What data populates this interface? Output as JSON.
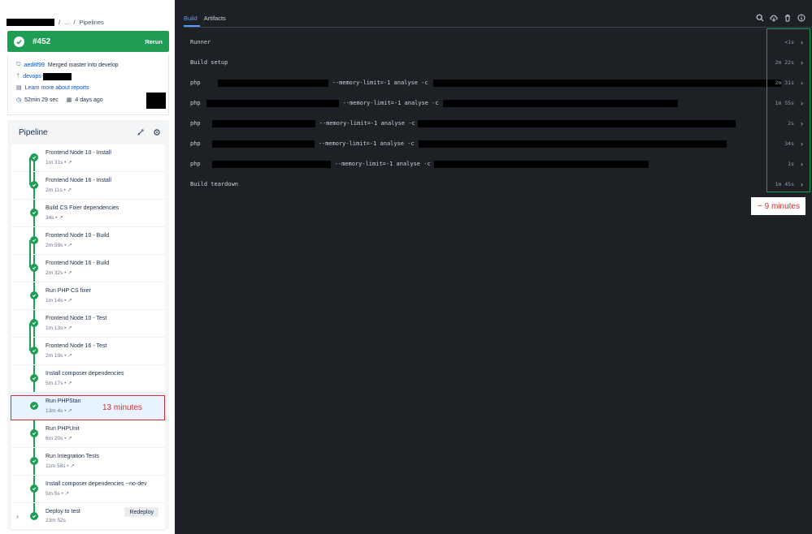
{
  "breadcrumb": {
    "sep1": "/",
    "ellipsis": "...",
    "sep2": "/",
    "current": "Pipelines"
  },
  "build": {
    "number": "#452",
    "rerun_label": "Rerun",
    "status_color": "#1f9d55"
  },
  "meta": {
    "commit_hash": "aed8f99",
    "commit_message": "Merged master into develop",
    "branch_prefix": "devops-",
    "reports_link": "Learn more about reports",
    "duration": "52min 29 sec",
    "age": "4 days ago"
  },
  "pipeline": {
    "title": "Pipeline",
    "steps": [
      {
        "name": "Frontend Node 10 - Install",
        "duration": "1m 31s",
        "arrow": "↗"
      },
      {
        "name": "Frontend Node 16 - Install",
        "duration": "2m 11s",
        "arrow": "↗"
      },
      {
        "name": "Build CS Fixer dependencies",
        "duration": "34s",
        "arrow": "↗"
      },
      {
        "name": "Frontend Node 10 - Build",
        "duration": "2m 59s",
        "arrow": "↗"
      },
      {
        "name": "Frontend Node 16 - Build",
        "duration": "2m 32s",
        "arrow": "↗"
      },
      {
        "name": "Run PHP CS fixer",
        "duration": "1m 14s",
        "arrow": "↗"
      },
      {
        "name": "Frontend Node 10 - Test",
        "duration": "1m 13s",
        "arrow": "↗"
      },
      {
        "name": "Frontend Node 16 - Test",
        "duration": "2m 19s",
        "arrow": "↗"
      },
      {
        "name": "Install composer dependencies",
        "duration": "5m 17s",
        "arrow": "↗"
      },
      {
        "name": "Run PHPStan",
        "duration": "13m 4s",
        "arrow": "↗"
      },
      {
        "name": "Run PHPUnit",
        "duration": "6m 20s",
        "arrow": "↗"
      },
      {
        "name": "Run Integration Tests",
        "duration": "11m 58s",
        "arrow": "↗"
      },
      {
        "name": "Install composer dependencies --no-dev",
        "duration": "5m 5s",
        "arrow": "↗"
      },
      {
        "name": "Deploy to test",
        "duration": "23m 52s",
        "arrow": ""
      }
    ],
    "redeploy_label": "Redeploy"
  },
  "annotations": {
    "phpstan": "13 minutes",
    "total": "~ 9 minutes"
  },
  "log": {
    "tabs": [
      "Build",
      "Artifacts"
    ],
    "rows": [
      {
        "prefix": "Runner",
        "mid": "",
        "suffix": "",
        "time": "<1s"
      },
      {
        "prefix": "Build setup",
        "mid": "",
        "suffix": "",
        "time": "2m 22s"
      },
      {
        "prefix": "php",
        "mid": "--memory-limit=-1 analyse -c",
        "suffix": "",
        "time": "2m 31s"
      },
      {
        "prefix": "php",
        "mid": "--memory-limit=-1 analyse -c",
        "suffix": "",
        "time": "1m 55s"
      },
      {
        "prefix": "php",
        "mid": "--memory-limit=-1 analyse -c",
        "suffix": "",
        "time": "2s"
      },
      {
        "prefix": "php",
        "mid": "--memory-limit=-1 analyse -c",
        "suffix": "",
        "time": "34s"
      },
      {
        "prefix": "php",
        "mid": "--memory-limit=-1 analyse -c",
        "suffix": "",
        "time": "1s"
      },
      {
        "prefix": "Build teardown",
        "mid": "",
        "suffix": "",
        "time": "1m 45s"
      }
    ]
  }
}
